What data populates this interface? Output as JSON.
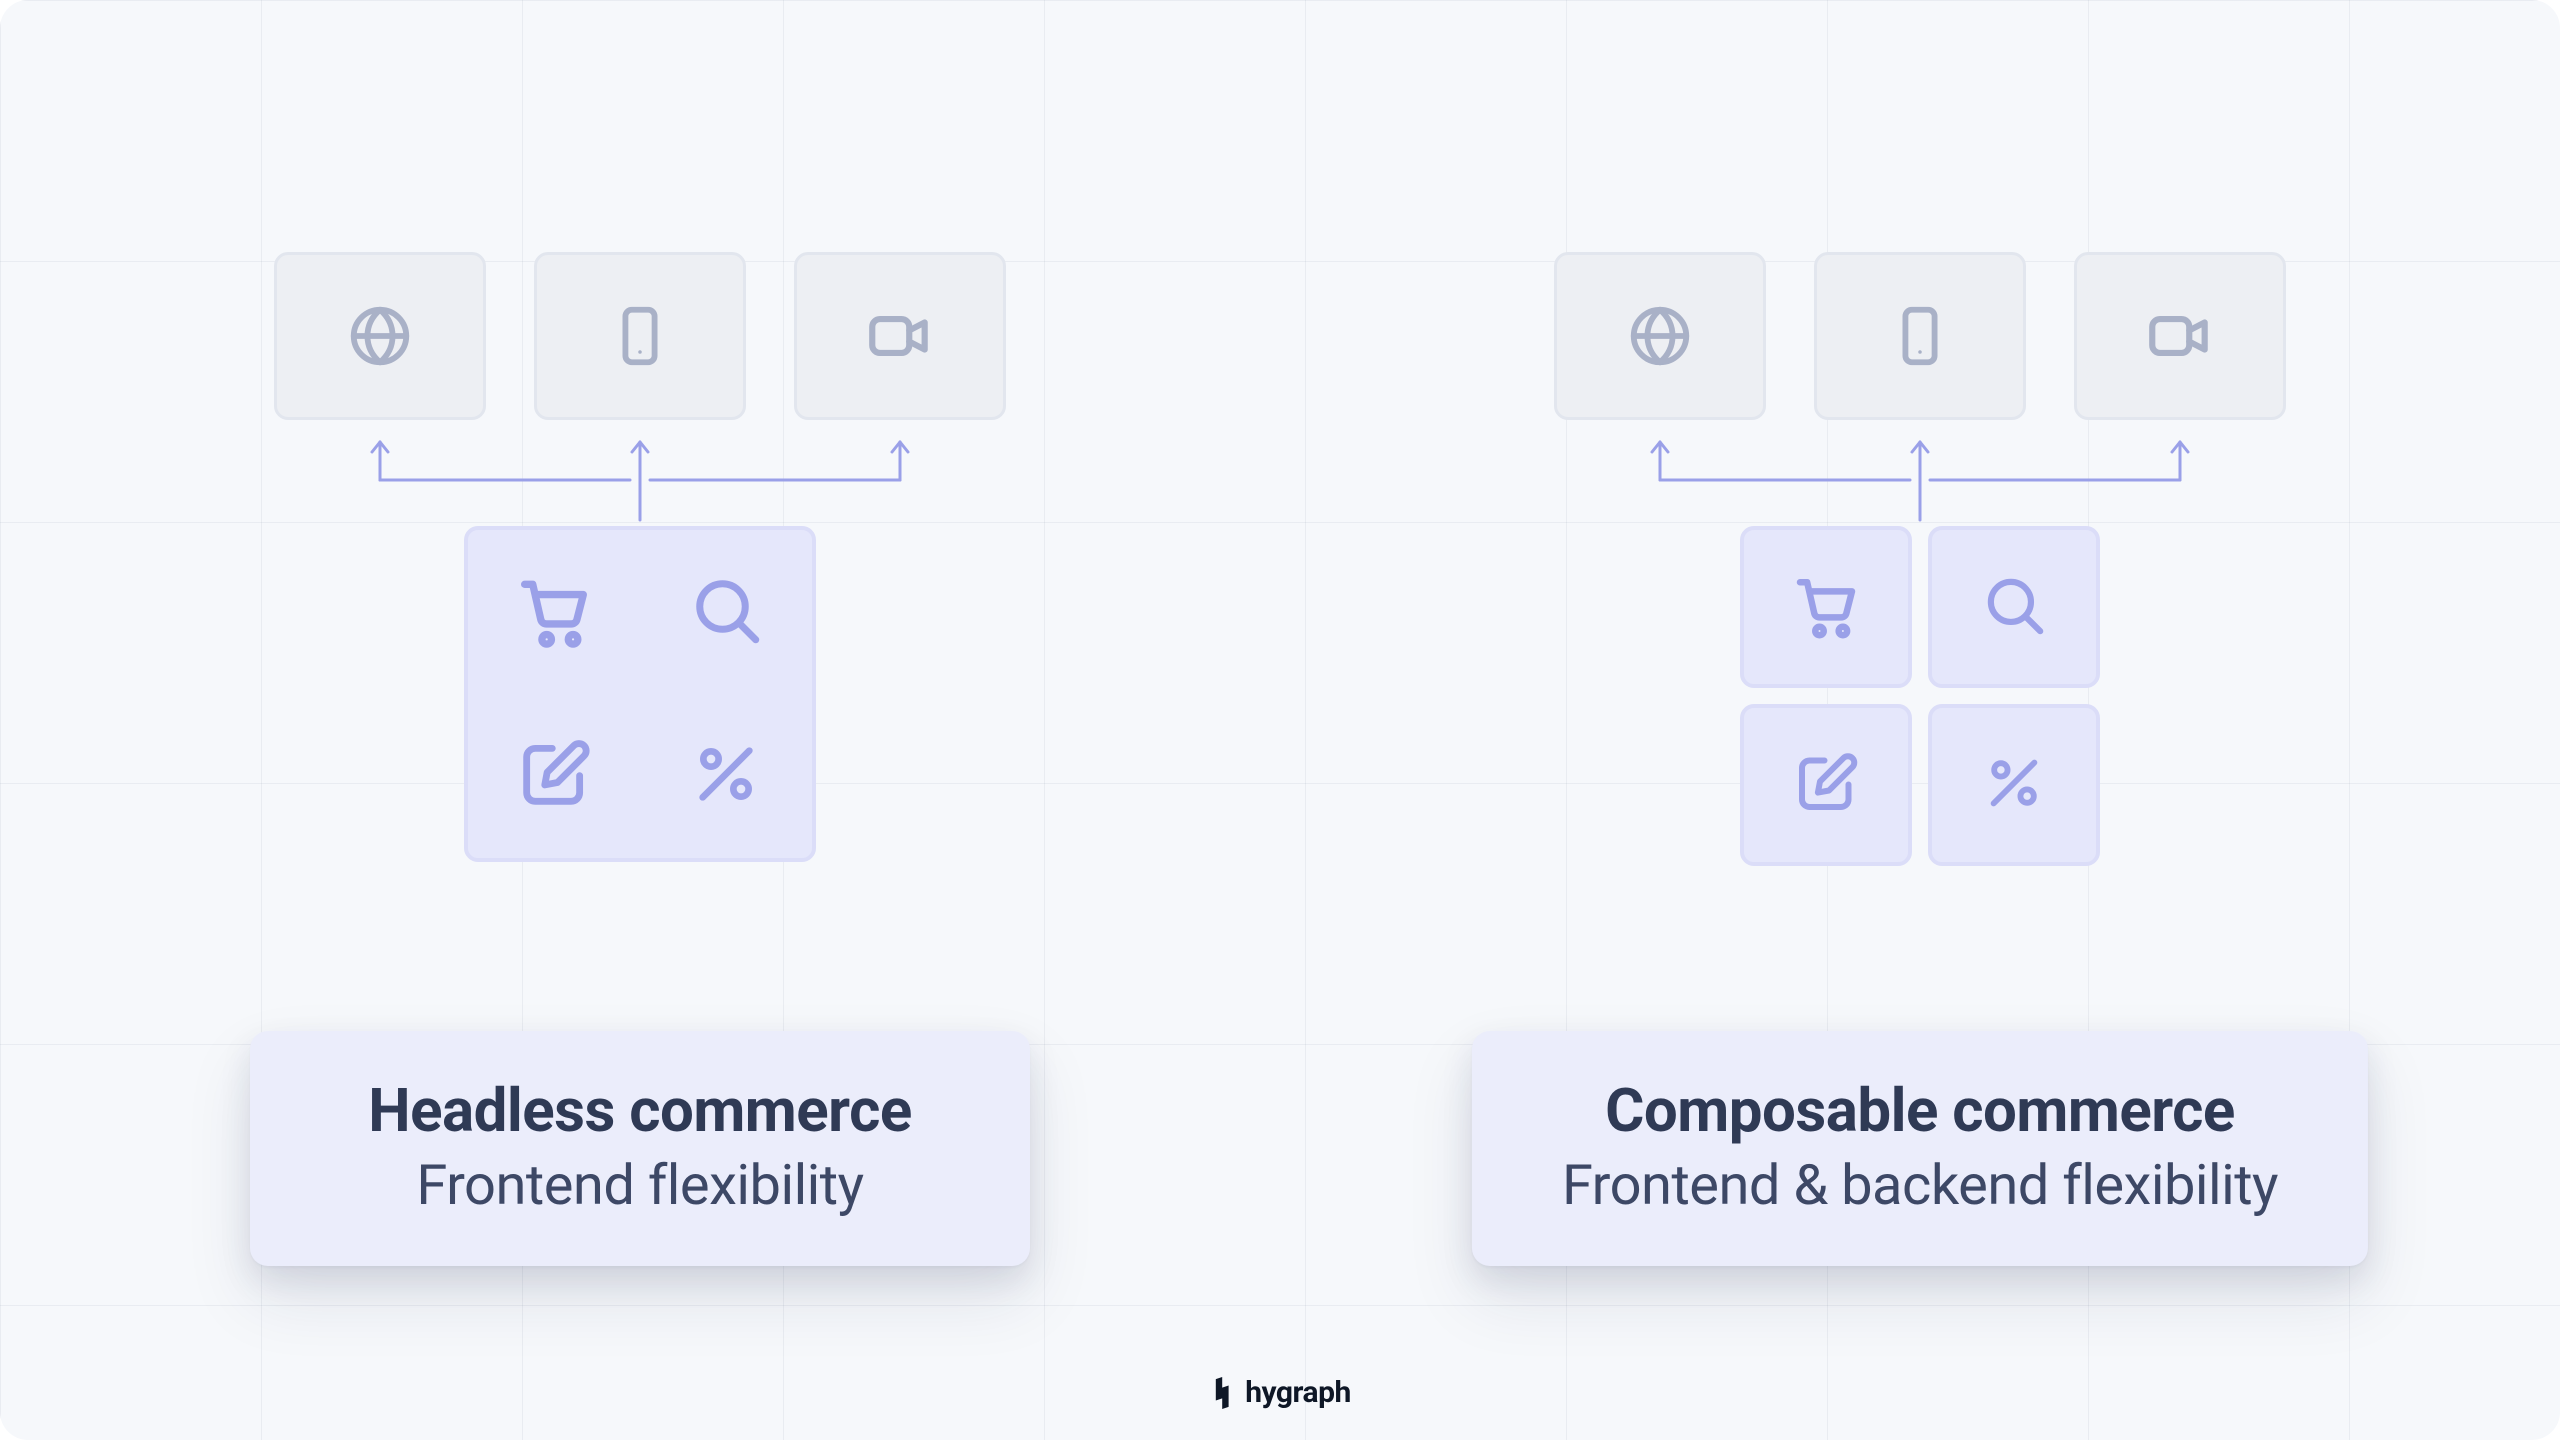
{
  "brand": {
    "name": "hygraph"
  },
  "left": {
    "title": "Headless commerce",
    "subtitle": "Frontend flexibility"
  },
  "right": {
    "title": "Composable commerce",
    "subtitle": "Frontend & backend flexibility"
  },
  "icons": {
    "channels": [
      "globe",
      "mobile",
      "video"
    ],
    "backend": [
      "cart",
      "search",
      "edit",
      "percent"
    ]
  },
  "colors": {
    "channel_bg": "#edeff3",
    "channel_border": "#e2e6ee",
    "channel_icon": "#a9b1c7",
    "backend_bg": "#e5e7fb",
    "backend_border": "#dbddf8",
    "backend_icon": "#9aa0e8",
    "connector": "#9aa0e8",
    "card_bg": "#ebedfb",
    "title_text": "#2f3a55",
    "subtitle_text": "#3d4866"
  }
}
